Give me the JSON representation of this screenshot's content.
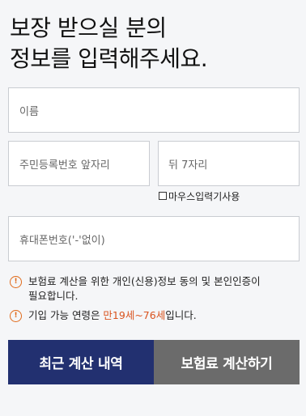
{
  "header": {
    "title_line1": "보장 받으실 분의",
    "title_line2": "정보를 입력해주세요."
  },
  "form": {
    "name_placeholder": "이름",
    "rrn_front_placeholder": "주민등록번호 앞자리",
    "rrn_back_placeholder": "뒤 7자리",
    "mouse_input_label": "마우스입력기사용",
    "phone_placeholder": "휴대폰번호('-'없이)"
  },
  "notices": {
    "consent_line1": "보험료 계산을 위한 개인(신용)정보 동의 및 본인인증이",
    "consent_line2": "필요합니다.",
    "age_prefix": "기입 가능 연령은 ",
    "age_range": "만19세~76세",
    "age_suffix": "입니다.",
    "icon_glyph": "!"
  },
  "buttons": {
    "recent_label": "최근 계산 내역",
    "calculate_label": "보험료 계산하기"
  },
  "colors": {
    "primary_navy": "#223070",
    "secondary_gray": "#6b6b6b",
    "warning_orange": "#e06a1a"
  }
}
